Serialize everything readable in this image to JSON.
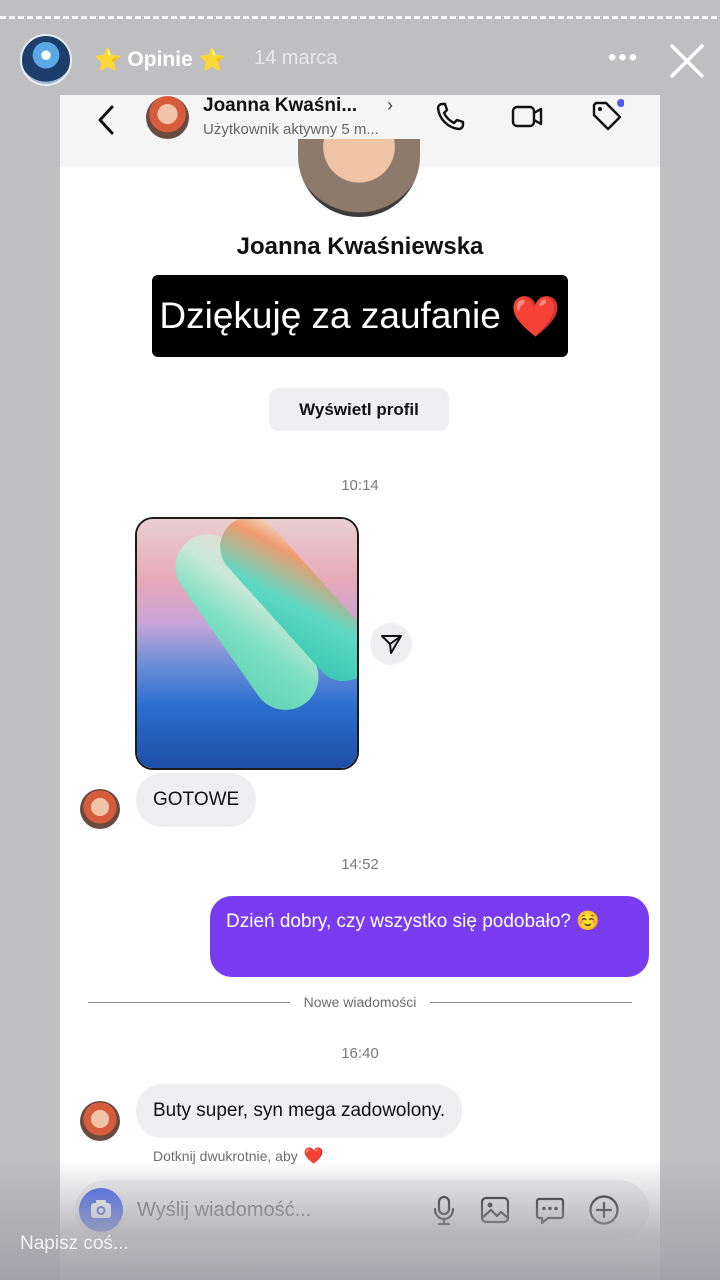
{
  "story": {
    "title": "Opinie",
    "star_left": "⭐",
    "star_right": "⭐",
    "date": "14 marca",
    "menu": "•••",
    "reply_placeholder": "Napisz coś..."
  },
  "chat": {
    "header": {
      "name": "Joanna Kwaśni...",
      "chevron": "›",
      "status": "Użytkownik aktywny 5 m..."
    },
    "profile": {
      "name": "Joanna Kwaśniewska",
      "overlay_text": "Dziękuję za zaufanie",
      "overlay_heart": "❤️",
      "view_profile_label": "Wyświetl profil"
    },
    "messages": [
      {
        "time": "10:14",
        "text": "GOTOWE"
      },
      {
        "time": "14:52",
        "text": "Dzień dobry, czy wszystko się podobało? ☺️"
      },
      {
        "time": "16:40",
        "text": "Buty super, syn mega zadowolony."
      }
    ],
    "new_messages_label": "Nowe wiadomości",
    "double_tap_hint": "Dotknij dwukrotnie, aby",
    "double_tap_heart": "❤️",
    "composer": {
      "placeholder": "Wyślij wiadomość..."
    }
  },
  "colors": {
    "outgoing_bubble": "#7a3cf0",
    "incoming_bubble": "#efeff1",
    "camera_button": "#3a5cf0",
    "heart": "#e0241f"
  },
  "icons": {
    "story_avatar": "brand-logo-icon",
    "close": "close-icon",
    "back": "chevron-left-icon",
    "call": "phone-icon",
    "video": "video-camera-icon",
    "tag": "tag-icon",
    "share": "share-icon",
    "camera": "camera-icon",
    "mic": "microphone-icon",
    "gallery": "image-icon",
    "sticker": "chat-bubble-icon",
    "add": "plus-icon"
  }
}
